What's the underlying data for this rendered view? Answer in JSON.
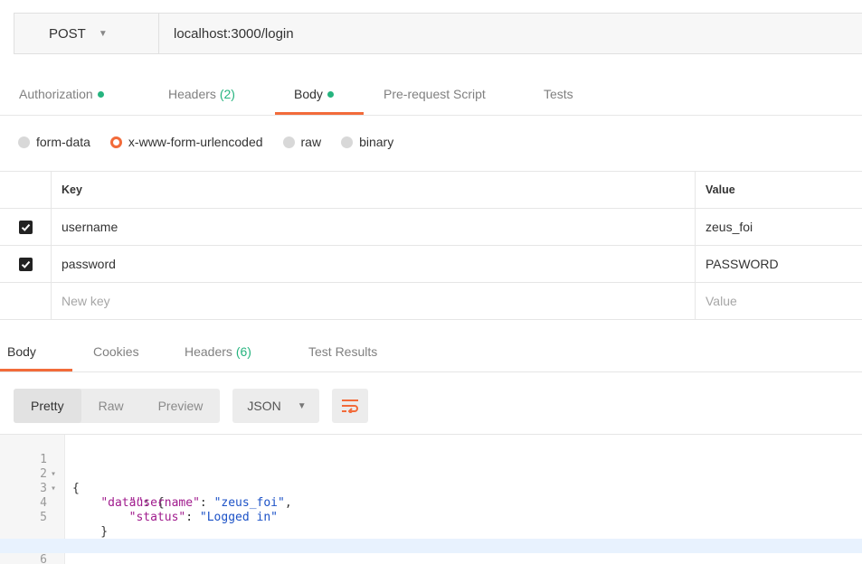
{
  "request": {
    "method": "POST",
    "url": "localhost:3000/login"
  },
  "request_tabs": [
    {
      "label": "Authorization",
      "indicator": "green-dot"
    },
    {
      "label": "Headers",
      "count": "(2)"
    },
    {
      "label": "Body",
      "indicator": "green-dot",
      "active": true
    },
    {
      "label": "Pre-request Script"
    },
    {
      "label": "Tests"
    }
  ],
  "body_types": [
    {
      "label": "form-data",
      "selected": false
    },
    {
      "label": "x-www-form-urlencoded",
      "selected": true
    },
    {
      "label": "raw",
      "selected": false
    },
    {
      "label": "binary",
      "selected": false
    }
  ],
  "params_table": {
    "headers": {
      "key": "Key",
      "value": "Value"
    },
    "rows": [
      {
        "checked": true,
        "key": "username",
        "value": "zeus_foi"
      },
      {
        "checked": true,
        "key": "password",
        "value": "PASSWORD"
      }
    ],
    "new_row": {
      "key_placeholder": "New key",
      "value_placeholder": "Value"
    }
  },
  "response_tabs": [
    {
      "label": "Body",
      "active": true
    },
    {
      "label": "Cookies"
    },
    {
      "label": "Headers",
      "count": "(6)"
    },
    {
      "label": "Test Results"
    }
  ],
  "view_modes": [
    "Pretty",
    "Raw",
    "Preview"
  ],
  "active_view_mode": "Pretty",
  "format": "JSON",
  "wrap_icon": "wrap-lines-icon",
  "response_code": {
    "line_numbers": [
      "1",
      "2",
      "3",
      "4",
      "5",
      "6"
    ],
    "lines": [
      "{",
      "    \"data\": {",
      "        \"username\": \"zeus_foi\",",
      "        \"status\": \"Logged in\"",
      "    }",
      "}"
    ],
    "tokens": {
      "data_key": "\"data\"",
      "username_key": "\"username\"",
      "username_val": "\"zeus_foi\"",
      "status_key": "\"status\"",
      "status_val": "\"Logged in\""
    }
  },
  "colors": {
    "accent": "#f26b3a",
    "indicator_green": "#26b47f",
    "json_key": "#a01b8d",
    "json_string": "#1c52c7"
  }
}
